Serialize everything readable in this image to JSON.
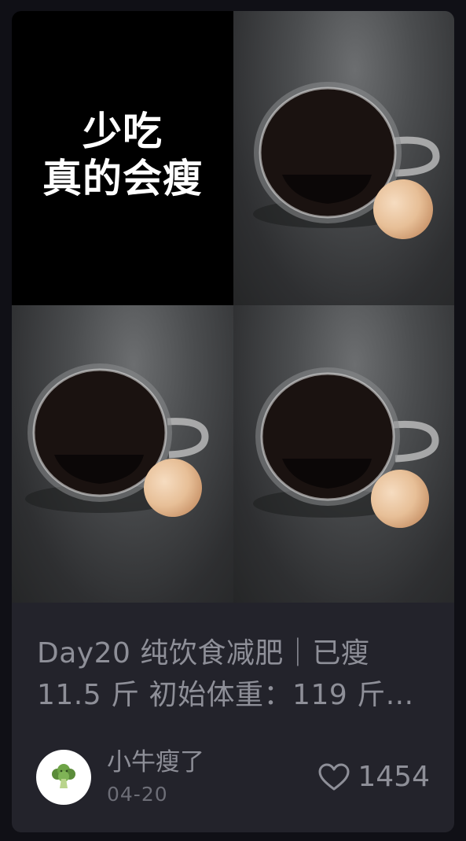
{
  "card": {
    "cover_text": {
      "line1": "少吃",
      "line2": "真的会瘦"
    },
    "photo_icons": [
      "coffee-cup-and-egg",
      "coffee-cup-and-egg",
      "coffee-cup-and-egg"
    ],
    "title_line1": "Day20 纯饮食减肥｜已瘦",
    "title_line2": "11.5 斤 初始体重：119 斤...",
    "author": {
      "avatar_icon": "broccoli-icon",
      "name": "小牛瘦了",
      "date": "04-20"
    },
    "likes": {
      "icon": "heart-icon",
      "count": "1454"
    }
  }
}
